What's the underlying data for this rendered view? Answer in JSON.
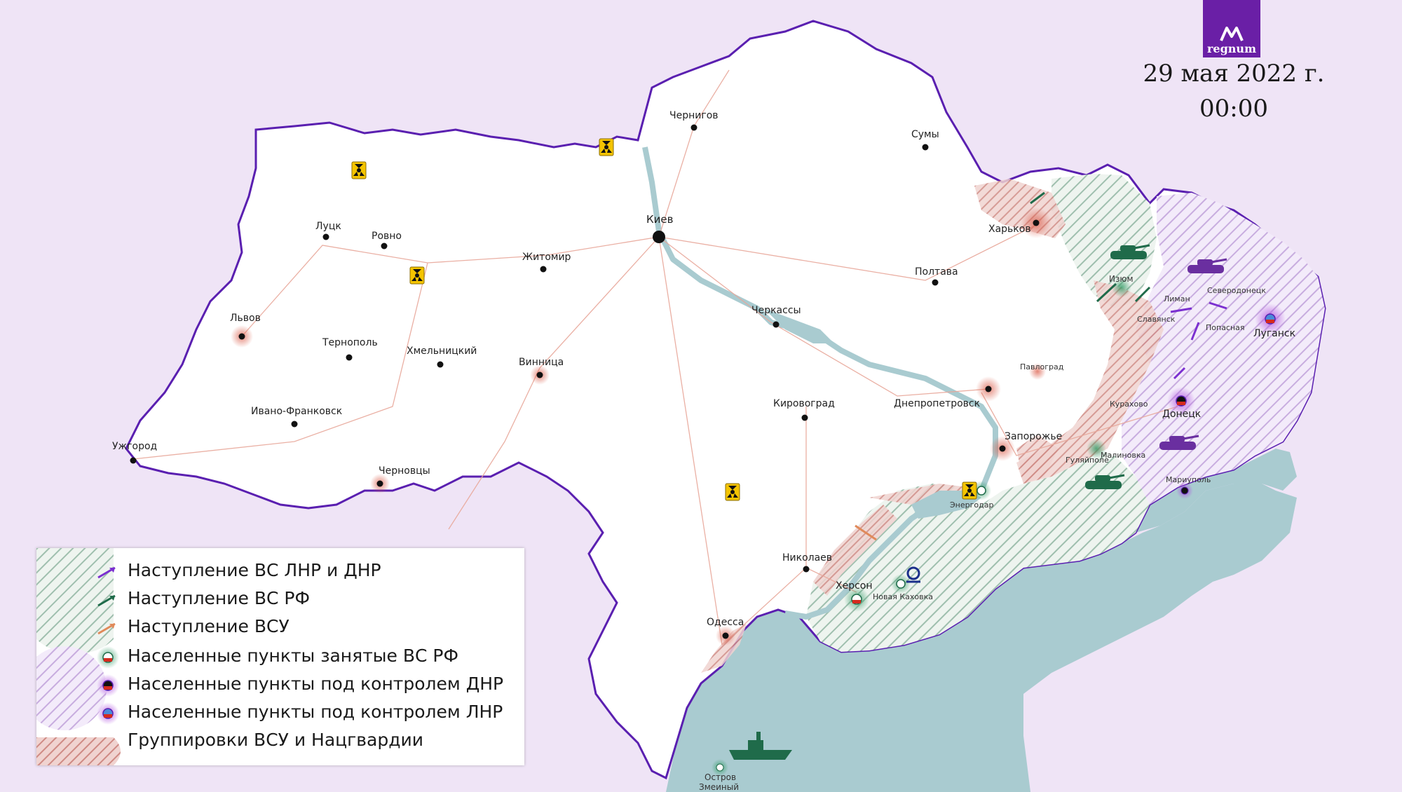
{
  "logo": {
    "text": "regnum"
  },
  "header": {
    "date": "29 мая 2022 г.",
    "time": "00:00"
  },
  "cities": {
    "kiev": "Киев",
    "chernigov": "Чернигов",
    "sumy": "Сумы",
    "kharkov": "Харьков",
    "poltava": "Полтава",
    "lutsk": "Луцк",
    "rovno": "Ровно",
    "zhitomir": "Житомир",
    "lvov": "Львов",
    "ternopol": "Тернополь",
    "khmelnitsky": "Хмельницкий",
    "vinnitsa": "Винница",
    "cherkassy": "Черкассы",
    "ivano_frankovsk": "Ивано-Франковск",
    "uzhgorod": "Ужгород",
    "chernovtsy": "Черновцы",
    "kirovograd": "Кировоград",
    "dnepropetrovsk": "Днепропетровск",
    "pavlograd": "Павлоград",
    "zaporozhye": "Запорожье",
    "nikolaev": "Николаев",
    "odessa": "Одесса",
    "kherson": "Херсон",
    "novaya_kakhovka": "Новая Каховка",
    "energodar": "Энергодар",
    "gulyaipole": "Гуляйполе",
    "malinovka": "Малиновка",
    "kurakhovo": "Курахово",
    "donetsk": "Донецк",
    "mariupol": "Мариуполь",
    "lugansk": "Луганск",
    "severodonetsk": "Северодонецк",
    "liman": "Лиман",
    "slavyansk": "Славянск",
    "popasnaya": "Попасная",
    "izyum": "Изюм",
    "zmeiny_1": "Остров",
    "zmeiny_2": "Змеиный"
  },
  "legend": {
    "items": [
      {
        "label": "Наступление ВС ЛНР и ДНР",
        "color": "#7b2fd0"
      },
      {
        "label": "Наступление ВС РФ",
        "color": "#1f6b4a"
      },
      {
        "label": "Наступление ВСУ",
        "color": "#e08a5a"
      },
      {
        "label": "Населенные пункты занятые ВС РФ",
        "color": "#2f8f5a"
      },
      {
        "label": "Населенные пункты под контролем ДНР",
        "color": "#8a3fd0"
      },
      {
        "label": "Населенные пункты под контролем ЛНР",
        "color": "#9a5ad8"
      },
      {
        "label": "Группировки ВСУ и Нацгвардии",
        "color": "#d99a95"
      }
    ]
  },
  "colors": {
    "background": "#efe4f6",
    "land": "#ffffff",
    "border": "#5a1fb0",
    "sea": "#a9cbd0",
    "russian_zone": "#8fb7a1",
    "lnr_dnr_zone": "#c7a9e0",
    "afu_groups": "#d99a95",
    "nuclear": "#f4c400"
  },
  "icons": [
    "nuclear-icon",
    "tank-icon",
    "ship-icon",
    "hydro-plant-icon",
    "arrow-icon"
  ]
}
